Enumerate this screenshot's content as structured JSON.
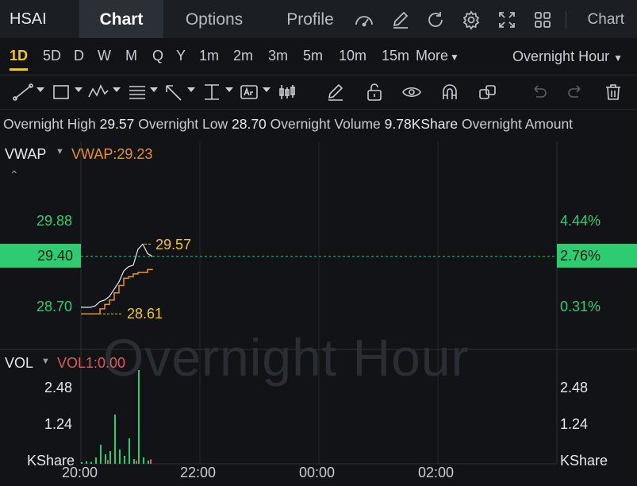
{
  "symbol": "HSAI",
  "tabs": [
    {
      "label": "Chart",
      "active": true
    },
    {
      "label": "Options",
      "active": false
    },
    {
      "label": "Profile",
      "active": false
    }
  ],
  "toolbar_icons": [
    "speedometer-icon",
    "edit-icon",
    "refresh-icon",
    "settings-icon",
    "fullscreen-icon",
    "grid-icon"
  ],
  "toolbar_right_label": "Chart",
  "periods": [
    {
      "label": "1D",
      "active": true
    },
    {
      "label": "5D"
    },
    {
      "label": "D"
    },
    {
      "label": "W"
    },
    {
      "label": "M"
    },
    {
      "label": "Q"
    },
    {
      "label": "Y"
    },
    {
      "label": "1m"
    },
    {
      "label": "2m"
    },
    {
      "label": "3m"
    },
    {
      "label": "5m"
    },
    {
      "label": "10m"
    },
    {
      "label": "15m"
    }
  ],
  "more_label": "More",
  "session_select": "Overnight Hour",
  "drawing_tools": [
    "trend-line-icon",
    "rectangle-icon",
    "pattern-icon",
    "fibonacci-icon",
    "arrow-icon",
    "measure-icon",
    "text-icon",
    "candle-icon",
    "pen-icon",
    "unlock-icon",
    "eye-icon",
    "magnet-icon",
    "layers-icon",
    "undo-icon",
    "redo-icon",
    "trash-icon"
  ],
  "info": {
    "high_label": "Overnight High",
    "high": "29.57",
    "low_label": "Overnight Low",
    "low": "28.70",
    "volume_label": "Overnight Volume",
    "volume": "9.78KShare",
    "amount_label": "Overnight Amount"
  },
  "price_pane": {
    "indicator_name": "VWAP",
    "indicator_value": "VWAP:29.23",
    "watermark": "Overnight Hour",
    "left_ticks": [
      "29.88",
      "28.70"
    ],
    "right_ticks": [
      "4.44%",
      "0.31%"
    ],
    "current_price": "29.40",
    "current_pct": "2.76%",
    "high_marker": "29.57",
    "low_marker": "28.61"
  },
  "volume_pane": {
    "indicator_name": "VOL",
    "indicator_value": "VOL1:0.00",
    "left_ticks": [
      "2.48",
      "1.24",
      "KShare"
    ],
    "right_ticks": [
      "2.48",
      "1.24",
      "KShare"
    ]
  },
  "x_axis": [
    "20:00",
    "22:00",
    "00:00",
    "02:00"
  ],
  "colors": {
    "up": "#2ecc71",
    "accent": "#f5c518",
    "vwap": "#e8902a",
    "vol_label": "#e05a5a",
    "background": "#111316"
  },
  "chart_data": {
    "type": "line",
    "price_line": [
      [
        0.0,
        28.7
      ],
      [
        0.02,
        28.7
      ],
      [
        0.04,
        28.7
      ],
      [
        0.06,
        28.72
      ],
      [
        0.08,
        28.78
      ],
      [
        0.1,
        28.8
      ],
      [
        0.12,
        28.85
      ],
      [
        0.14,
        28.95
      ],
      [
        0.16,
        29.05
      ],
      [
        0.18,
        29.2
      ],
      [
        0.2,
        29.26
      ],
      [
        0.22,
        29.28
      ],
      [
        0.24,
        29.5
      ],
      [
        0.26,
        29.57
      ],
      [
        0.28,
        29.44
      ],
      [
        0.3,
        29.4
      ]
    ],
    "vwap_line": [
      [
        0.0,
        28.61
      ],
      [
        0.06,
        28.61
      ],
      [
        0.08,
        28.68
      ],
      [
        0.1,
        28.74
      ],
      [
        0.12,
        28.8
      ],
      [
        0.14,
        28.9
      ],
      [
        0.16,
        29.0
      ],
      [
        0.18,
        29.1
      ],
      [
        0.2,
        29.12
      ],
      [
        0.22,
        29.16
      ],
      [
        0.24,
        29.18
      ],
      [
        0.28,
        29.22
      ],
      [
        0.3,
        29.23
      ]
    ],
    "volume_bars": [
      [
        0.0,
        0.05
      ],
      [
        0.02,
        0.08
      ],
      [
        0.04,
        0.06
      ],
      [
        0.06,
        0.2
      ],
      [
        0.08,
        0.6
      ],
      [
        0.1,
        0.3
      ],
      [
        0.12,
        0.4
      ],
      [
        0.14,
        1.55
      ],
      [
        0.16,
        0.45
      ],
      [
        0.18,
        0.25
      ],
      [
        0.2,
        0.8
      ],
      [
        0.22,
        0.15
      ],
      [
        0.24,
        2.95
      ],
      [
        0.26,
        0.2
      ],
      [
        0.28,
        0.1
      ]
    ],
    "volume_red_bars": [
      [
        0.1,
        0.12
      ],
      [
        0.22,
        0.1
      ],
      [
        0.28,
        0.14
      ]
    ],
    "price_ylim": [
      28.45,
      30.05
    ],
    "volume_ylim": [
      0,
      3.0
    ]
  }
}
